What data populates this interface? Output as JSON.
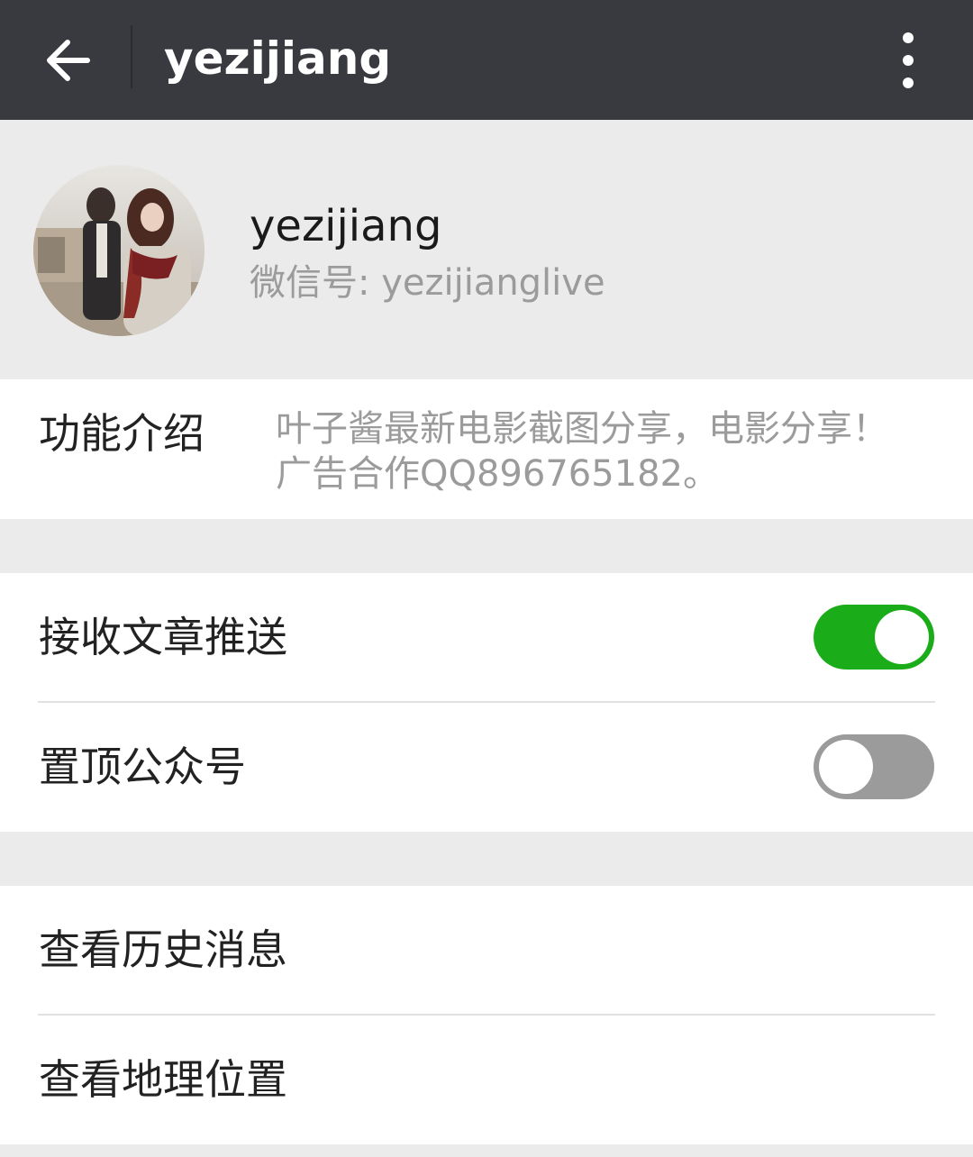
{
  "header": {
    "title": "yezijiang",
    "back_icon": "arrow-left-icon",
    "more_icon": "more-vertical-icon"
  },
  "profile": {
    "name": "yezijiang",
    "wechat_id": "微信号: yezijianglive",
    "avatar_icon": "avatar-photo"
  },
  "intro": {
    "label": "功能介绍",
    "lines": [
      "叶子酱最新电影截图分享，电影分享！",
      "广告合作QQ896765182。"
    ]
  },
  "settings": {
    "receive_push": {
      "label": "接收文章推送",
      "on": true
    },
    "pin_account": {
      "label": "置顶公众号",
      "on": false
    }
  },
  "actions": {
    "history": "查看历史消息",
    "location": "查看地理位置"
  },
  "colors": {
    "topbar": "#393a3f",
    "toggle_on": "#1aad19",
    "toggle_off": "#9b9b9b"
  }
}
